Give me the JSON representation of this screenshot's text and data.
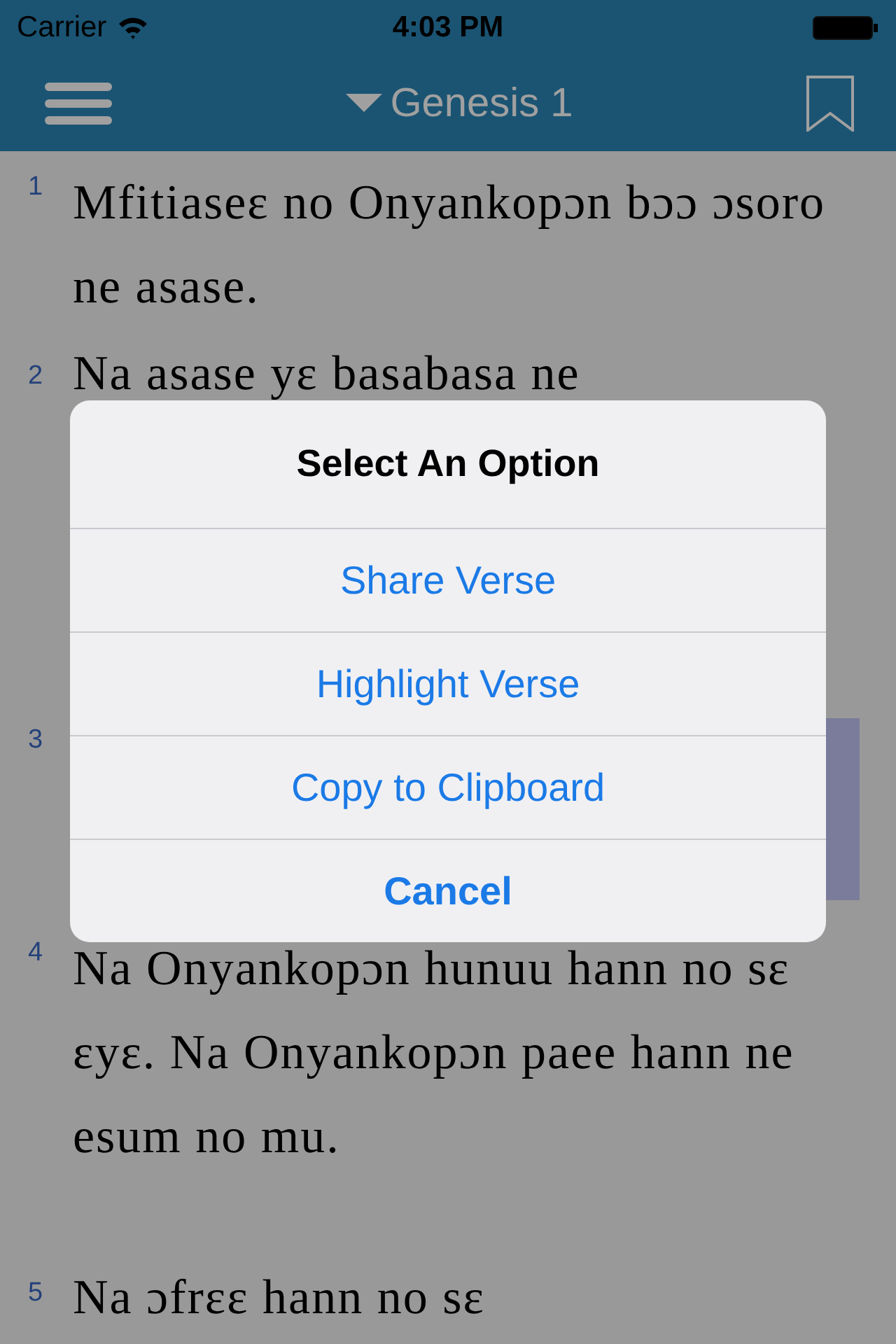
{
  "status_bar": {
    "carrier": "Carrier",
    "time": "4:03 PM"
  },
  "nav_bar": {
    "title": "Genesis 1"
  },
  "verses": [
    {
      "number": "1",
      "text": "Mfitiaseɛ no Onyankopɔn bɔɔ ɔsoro ne asase.",
      "highlighted": false
    },
    {
      "number": "2",
      "text": "Na asase yɛ basabasa ne",
      "highlighted": false
    },
    {
      "number": "3",
      "highlighted": true
    },
    {
      "number": "4",
      "text": "Na Onyankopɔn hunuu hann no sɛ ɛyɛ. Na Onyankopɔn paee hann ne esum no mu.",
      "highlighted": false
    },
    {
      "number": "5",
      "text": "Na ɔfrɛɛ hann no sɛ",
      "highlighted": false
    }
  ],
  "alert": {
    "title": "Select An Option",
    "actions": [
      {
        "label": "Share Verse",
        "kind": "default"
      },
      {
        "label": "Highlight Verse",
        "kind": "default"
      },
      {
        "label": "Copy to Clipboard",
        "kind": "default"
      },
      {
        "label": "Cancel",
        "kind": "cancel"
      }
    ]
  }
}
